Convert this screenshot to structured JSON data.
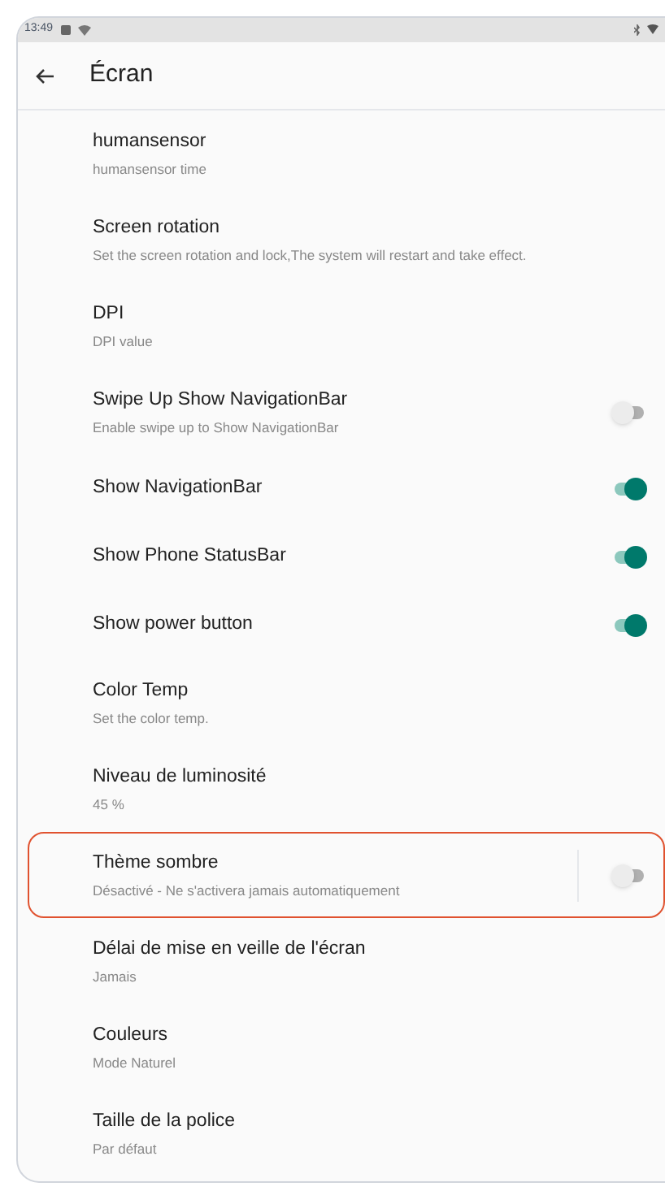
{
  "status_bar": {
    "time": "13:49"
  },
  "header": {
    "title": "Écran"
  },
  "items": [
    {
      "kind": "text",
      "title": "humansensor",
      "summary": "humansensor time"
    },
    {
      "kind": "text",
      "title": "Screen rotation",
      "summary": "Set the screen rotation and lock,The system will restart and take effect."
    },
    {
      "kind": "text",
      "title": "DPI",
      "summary": "DPI value"
    },
    {
      "kind": "switch",
      "title": "Swipe Up Show NavigationBar",
      "summary": "Enable swipe up to Show NavigationBar",
      "on": false
    },
    {
      "kind": "switch",
      "title": "Show NavigationBar",
      "on": true
    },
    {
      "kind": "switch",
      "title": "Show Phone StatusBar",
      "on": true
    },
    {
      "kind": "switch",
      "title": "Show power button",
      "on": true
    },
    {
      "kind": "text",
      "title": "Color Temp",
      "summary": "Set the color temp."
    },
    {
      "kind": "text",
      "title": "Niveau de luminosité",
      "summary": "45 %"
    },
    {
      "kind": "split-switch",
      "title": "Thème sombre",
      "summary": "Désactivé - Ne s'activera jamais automatiquement",
      "on": false,
      "highlighted": true
    },
    {
      "kind": "text",
      "title": "Délai de mise en veille de l'écran",
      "summary": "Jamais"
    },
    {
      "kind": "text",
      "title": "Couleurs",
      "summary": "Mode Naturel"
    },
    {
      "kind": "text",
      "title": "Taille de la police",
      "summary": "Par défaut"
    }
  ]
}
